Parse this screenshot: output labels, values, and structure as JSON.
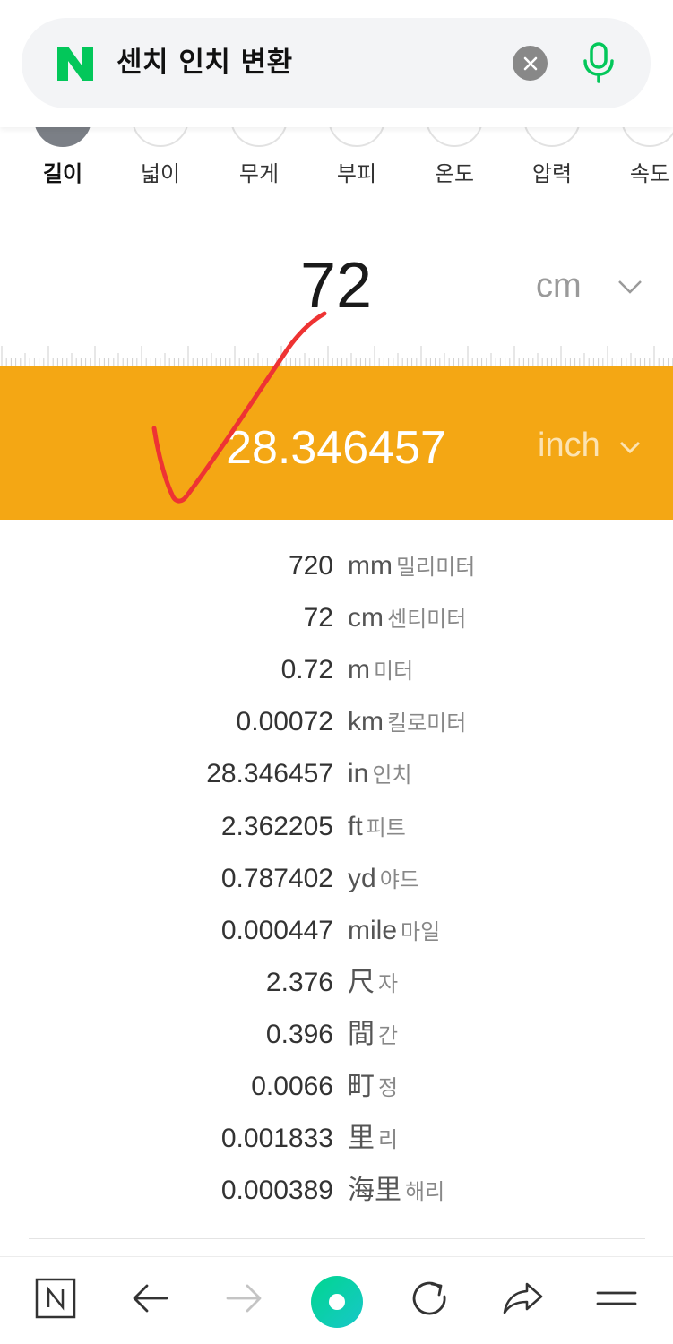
{
  "search": {
    "query": "센치 인치 변환",
    "logo_letter": "N"
  },
  "tabs": [
    {
      "label": "길이",
      "active": true
    },
    {
      "label": "넓이",
      "active": false
    },
    {
      "label": "무게",
      "active": false
    },
    {
      "label": "부피",
      "active": false
    },
    {
      "label": "온도",
      "active": false
    },
    {
      "label": "압력",
      "active": false
    },
    {
      "label": "속도",
      "active": false
    }
  ],
  "converter": {
    "input_value": "72",
    "input_unit": "cm",
    "output_value": "28.346457",
    "output_unit": "inch"
  },
  "results": [
    {
      "value": "720",
      "unit": "mm",
      "name": "밀리미터"
    },
    {
      "value": "72",
      "unit": "cm",
      "name": "센티미터"
    },
    {
      "value": "0.72",
      "unit": "m",
      "name": "미터"
    },
    {
      "value": "0.00072",
      "unit": "km",
      "name": "킬로미터"
    },
    {
      "value": "28.346457",
      "unit": "in",
      "name": "인치"
    },
    {
      "value": "2.362205",
      "unit": "ft",
      "name": "피트"
    },
    {
      "value": "0.787402",
      "unit": "yd",
      "name": "야드"
    },
    {
      "value": "0.000447",
      "unit": "mile",
      "name": "마일"
    },
    {
      "value": "2.376",
      "unit": "尺",
      "name": "자"
    },
    {
      "value": "0.396",
      "unit": "間",
      "name": "간"
    },
    {
      "value": "0.0066",
      "unit": "町",
      "name": "정"
    },
    {
      "value": "0.001833",
      "unit": "里",
      "name": "리"
    },
    {
      "value": "0.000389",
      "unit": "海里",
      "name": "해리"
    }
  ],
  "colors": {
    "accent": "#f4a714",
    "naver_green": "#03c75a",
    "annotation_red": "#ee3333"
  },
  "icons": {
    "nav": [
      "naver-home-icon",
      "back-arrow-icon",
      "forward-arrow-icon",
      "green-dot-icon",
      "refresh-icon",
      "share-icon",
      "menu-icon"
    ]
  }
}
